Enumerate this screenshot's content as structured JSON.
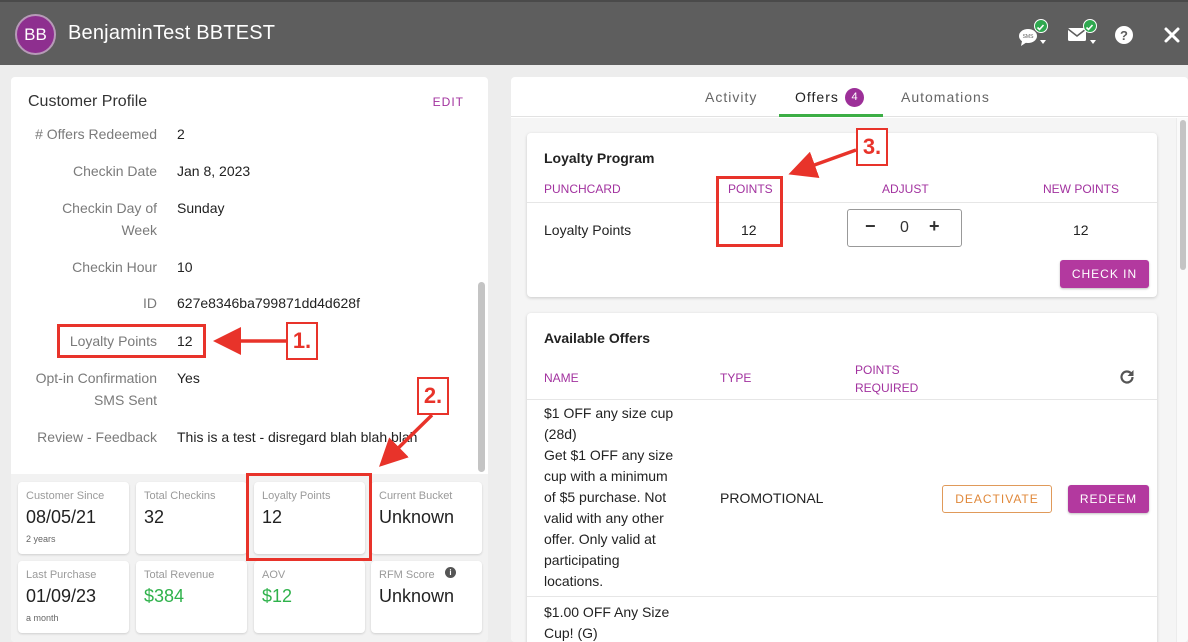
{
  "header": {
    "avatar_initials": "BB",
    "title": "BenjaminTest BBTEST",
    "sms_label": "SMS",
    "icons": [
      "sms-status-icon",
      "email-status-icon",
      "help-icon",
      "close-icon"
    ]
  },
  "profile": {
    "title": "Customer Profile",
    "edit_label": "EDIT",
    "fields": [
      {
        "label": "# Offers Redeemed",
        "value": "2"
      },
      {
        "label": "Checkin Date",
        "value": "Jan 8, 2023"
      },
      {
        "label": "Checkin Day of",
        "label2": "Week",
        "value": "Sunday"
      },
      {
        "label": "Checkin Hour",
        "value": "10"
      },
      {
        "label": "ID",
        "value": "627e8346ba799871dd4d628f"
      },
      {
        "label": "Loyalty Points",
        "value": "12"
      },
      {
        "label": "Opt-in Confirmation",
        "label2": "SMS Sent",
        "value": "Yes"
      },
      {
        "label": "Review - Feedback",
        "value": "This is a test - disregard blah blah blah"
      }
    ]
  },
  "stats": [
    {
      "label": "Customer Since",
      "value": "08/05/21",
      "sub": "2 years"
    },
    {
      "label": "Total Checkins",
      "value": "32",
      "sub": ""
    },
    {
      "label": "Loyalty Points",
      "value": "12",
      "sub": ""
    },
    {
      "label": "Current Bucket",
      "value": "Unknown",
      "sub": ""
    },
    {
      "label": "Last Purchase",
      "value": "01/09/23",
      "sub": "a month"
    },
    {
      "label": "Total Revenue",
      "value": "$384",
      "sub": ""
    },
    {
      "label": "AOV",
      "value": "$12",
      "sub": ""
    },
    {
      "label": "RFM Score",
      "value": "Unknown",
      "sub": ""
    }
  ],
  "tabs": {
    "activity": "Activity",
    "offers": "Offers",
    "offers_count": "4",
    "automations": "Automations"
  },
  "loyalty": {
    "title": "Loyalty Program",
    "col_punchcard": "PUNCHCARD",
    "col_points": "POINTS",
    "col_adjust": "ADJUST",
    "col_new_points": "NEW POINTS",
    "row_name": "Loyalty Points",
    "points": "12",
    "adjust": "0",
    "new_points": "12",
    "checkin_label": "CHECK IN"
  },
  "offers": {
    "title": "Available Offers",
    "col_name": "NAME",
    "col_type": "TYPE",
    "col_points_1": "POINTS",
    "col_points_2": "REQUIRED",
    "items": [
      {
        "lines": [
          "$1 OFF any size cup",
          "(28d)",
          "Get $1 OFF any size",
          "cup with a minimum",
          "of $5 purchase. Not",
          "valid with any other",
          "offer. Only valid at",
          "participating",
          "locations."
        ],
        "type": "PROMOTIONAL",
        "deactivate": "DEACTIVATE",
        "redeem": "REDEEM"
      },
      {
        "lines": [
          "$1.00 OFF Any Size",
          "Cup! (G)"
        ]
      }
    ]
  },
  "annotations": {
    "one": "1.",
    "two": "2.",
    "three": "3."
  },
  "colors": {
    "accent": "#a2329f",
    "annotation": "#e8332a",
    "success": "#2fb24b"
  }
}
